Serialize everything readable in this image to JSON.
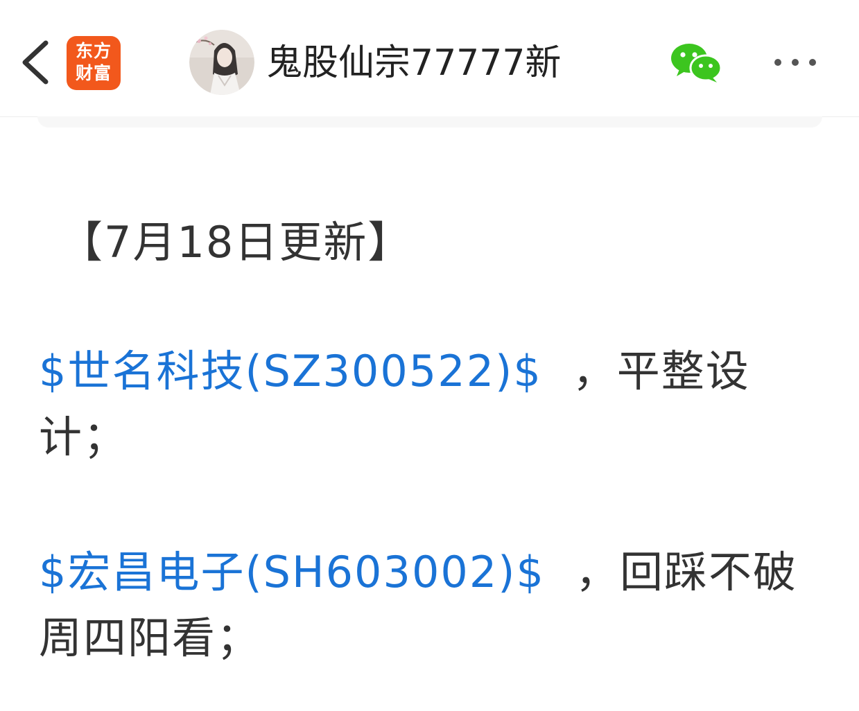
{
  "header": {
    "app_logo_line1": "东方",
    "app_logo_line2": "财富",
    "title": "鬼股仙宗77777新",
    "icons": {
      "back": "chevron-left-icon",
      "share": "wechat-icon",
      "more": "more-dots-icon"
    }
  },
  "post": {
    "heading": "【7月18日更新】",
    "items": [
      {
        "stock_link": "$世名科技(SZ300522)$",
        "text": "，平整设计；"
      },
      {
        "stock_link": "$宏昌电子(SH603002)$",
        "text": "，回踩不破周四阳看；"
      }
    ]
  },
  "colors": {
    "brand": "#f2581c",
    "link": "#1a73d6",
    "wechat": "#3cc51f",
    "text": "#333333"
  }
}
